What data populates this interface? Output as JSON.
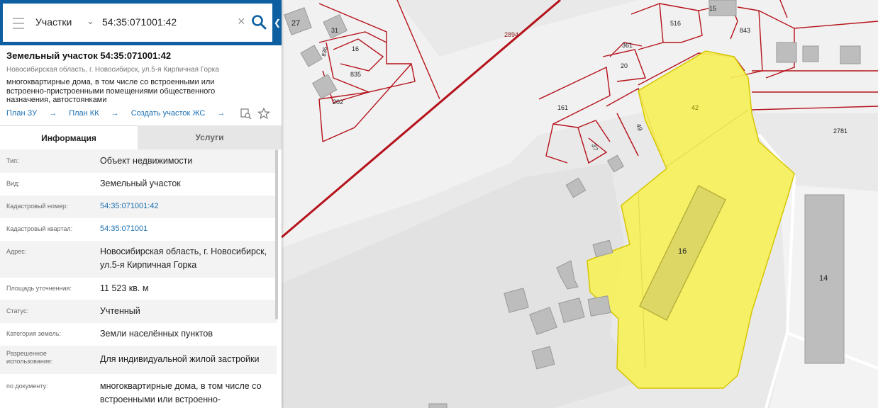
{
  "search": {
    "layer": "Участки",
    "query": "54:35:071001:42"
  },
  "parcel": {
    "title": "Земельный участок 54:35:071001:42",
    "address_short": "Новосибирская область, г. Новосибирск, ул.5-я Кирпичная Горка",
    "description": "многоквартирные дома, в том числе со встроенными или встроенно-пристроенными помещениями общественного назначения, автостоянками"
  },
  "links": {
    "plan_zu": "План ЗУ",
    "plan_kk": "План КК",
    "create_zhs": "Создать участок ЖС"
  },
  "tabs": {
    "info": "Информация",
    "services": "Услуги"
  },
  "rows": [
    {
      "label": "Тип:",
      "value": "Объект недвижимости"
    },
    {
      "label": "Вид:",
      "value": "Земельный участок"
    },
    {
      "label": "Кадастровый номер:",
      "value": "54:35:071001:42"
    },
    {
      "label": "Кадастровый квартал:",
      "value": "54:35:071001"
    },
    {
      "label": "Адрес:",
      "value": "Новосибирская область, г. Новосибирск, ул.5-я Кирпичная Горка"
    },
    {
      "label": "Площадь уточненная:",
      "value": "11 523 кв. м"
    },
    {
      "label": "Статус:",
      "value": "Учтенный"
    },
    {
      "label": "Категория земель:",
      "value": "Земли населённых пунктов"
    },
    {
      "label": "Разрешенное использование:",
      "value": "Для индивидуальной жилой застройки"
    },
    {
      "label": "по документу:",
      "value": "многоквартирные дома, в том числе со встроенными или встроенно-"
    }
  ],
  "map_labels": {
    "l27": "27",
    "l31": "31",
    "l836": "836",
    "l16a": "16",
    "l835": "835",
    "l202": "202",
    "l2894": "2894",
    "l15": "15",
    "l516": "516",
    "l843": "843",
    "l361": "361",
    "l20": "20",
    "l161": "161",
    "l37": "37",
    "l49": "49",
    "l42": "42",
    "l2781": "2781",
    "l16": "16",
    "l14": "14"
  },
  "colors": {
    "header": "#0d5fa1",
    "parcel_fill": "#f5f05a",
    "boundary": "#b5121b",
    "link": "#1a6fb0"
  }
}
